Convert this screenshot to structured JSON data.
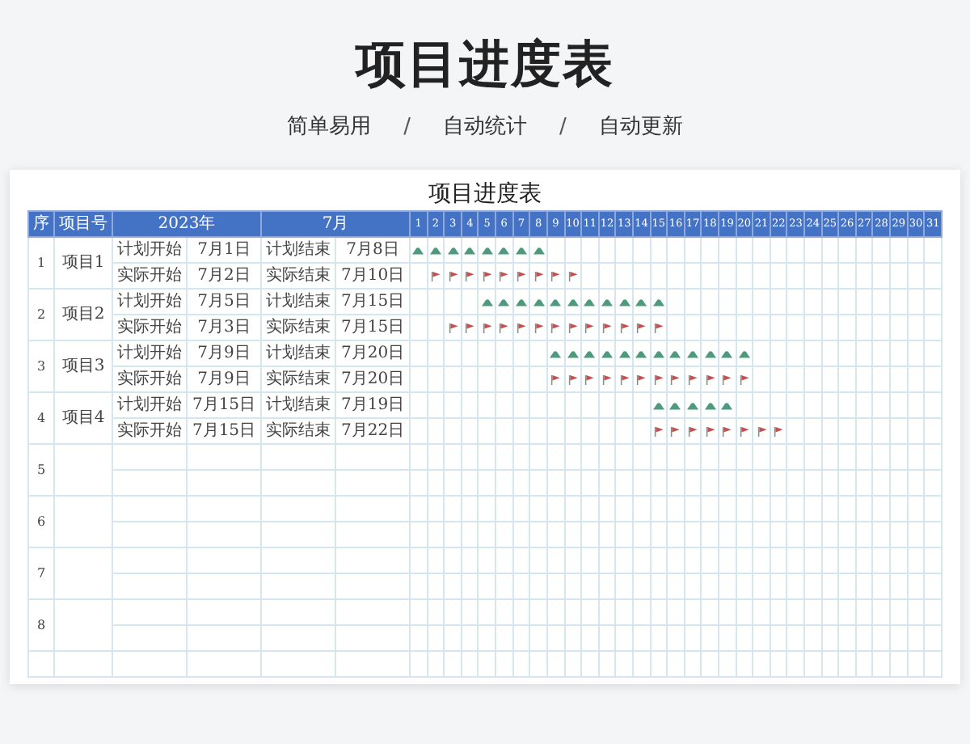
{
  "page_title": "项目进度表",
  "subtitle": [
    {
      "kind": "feature",
      "text": "简单易用"
    },
    {
      "kind": "separator",
      "text": "/"
    },
    {
      "kind": "feature",
      "text": "自动统计"
    },
    {
      "kind": "separator",
      "text": "/"
    },
    {
      "kind": "feature",
      "text": "自动更新"
    }
  ],
  "sheet": {
    "title": "项目进度表",
    "header": {
      "seq": "序",
      "project": "项目号",
      "year": "2023年",
      "month": "7月",
      "days": [
        "1",
        "2",
        "3",
        "4",
        "5",
        "6",
        "7",
        "8",
        "9",
        "10",
        "11",
        "12",
        "13",
        "14",
        "15",
        "16",
        "17",
        "18",
        "19",
        "20",
        "21",
        "22",
        "23",
        "24",
        "25",
        "26",
        "27",
        "28",
        "29",
        "30",
        "31"
      ]
    },
    "projects": [
      {
        "seq": "1",
        "name": "项目1",
        "rows": [
          {
            "kind": "plan",
            "start_label": "计划开始",
            "start": "7月1日",
            "end_label": "计划结束",
            "end": "7月8日",
            "marked": [
              true,
              true,
              true,
              true,
              true,
              true,
              true,
              true,
              false,
              false,
              false,
              false,
              false,
              false,
              false,
              false,
              false,
              false,
              false,
              false,
              false,
              false,
              false,
              false,
              false,
              false,
              false,
              false,
              false,
              false,
              false
            ]
          },
          {
            "kind": "actual",
            "start_label": "实际开始",
            "start": "7月2日",
            "end_label": "实际结束",
            "end": "7月10日",
            "marked": [
              false,
              true,
              true,
              true,
              true,
              true,
              true,
              true,
              true,
              true,
              false,
              false,
              false,
              false,
              false,
              false,
              false,
              false,
              false,
              false,
              false,
              false,
              false,
              false,
              false,
              false,
              false,
              false,
              false,
              false,
              false
            ]
          }
        ]
      },
      {
        "seq": "2",
        "name": "项目2",
        "rows": [
          {
            "kind": "plan",
            "start_label": "计划开始",
            "start": "7月5日",
            "end_label": "计划结束",
            "end": "7月15日",
            "marked": [
              false,
              false,
              false,
              false,
              true,
              true,
              true,
              true,
              true,
              true,
              true,
              true,
              true,
              true,
              true,
              false,
              false,
              false,
              false,
              false,
              false,
              false,
              false,
              false,
              false,
              false,
              false,
              false,
              false,
              false,
              false
            ]
          },
          {
            "kind": "actual",
            "start_label": "实际开始",
            "start": "7月3日",
            "end_label": "实际结束",
            "end": "7月15日",
            "marked": [
              false,
              false,
              true,
              true,
              true,
              true,
              true,
              true,
              true,
              true,
              true,
              true,
              true,
              true,
              true,
              false,
              false,
              false,
              false,
              false,
              false,
              false,
              false,
              false,
              false,
              false,
              false,
              false,
              false,
              false,
              false
            ]
          }
        ]
      },
      {
        "seq": "3",
        "name": "项目3",
        "rows": [
          {
            "kind": "plan",
            "start_label": "计划开始",
            "start": "7月9日",
            "end_label": "计划结束",
            "end": "7月20日",
            "marked": [
              false,
              false,
              false,
              false,
              false,
              false,
              false,
              false,
              true,
              true,
              true,
              true,
              true,
              true,
              true,
              true,
              true,
              true,
              true,
              true,
              false,
              false,
              false,
              false,
              false,
              false,
              false,
              false,
              false,
              false,
              false
            ]
          },
          {
            "kind": "actual",
            "start_label": "实际开始",
            "start": "7月9日",
            "end_label": "实际结束",
            "end": "7月20日",
            "marked": [
              false,
              false,
              false,
              false,
              false,
              false,
              false,
              false,
              true,
              true,
              true,
              true,
              true,
              true,
              true,
              true,
              true,
              true,
              true,
              true,
              false,
              false,
              false,
              false,
              false,
              false,
              false,
              false,
              false,
              false,
              false
            ]
          }
        ]
      },
      {
        "seq": "4",
        "name": "项目4",
        "rows": [
          {
            "kind": "plan",
            "start_label": "计划开始",
            "start": "7月15日",
            "end_label": "计划结束",
            "end": "7月19日",
            "marked": [
              false,
              false,
              false,
              false,
              false,
              false,
              false,
              false,
              false,
              false,
              false,
              false,
              false,
              false,
              true,
              true,
              true,
              true,
              true,
              false,
              false,
              false,
              false,
              false,
              false,
              false,
              false,
              false,
              false,
              false,
              false
            ]
          },
          {
            "kind": "actual",
            "start_label": "实际开始",
            "start": "7月15日",
            "end_label": "实际结束",
            "end": "7月22日",
            "marked": [
              false,
              false,
              false,
              false,
              false,
              false,
              false,
              false,
              false,
              false,
              false,
              false,
              false,
              false,
              true,
              true,
              true,
              true,
              true,
              true,
              true,
              true,
              false,
              false,
              false,
              false,
              false,
              false,
              false,
              false,
              false
            ]
          }
        ]
      },
      {
        "seq": "5"
      },
      {
        "seq": "6"
      },
      {
        "seq": "7"
      },
      {
        "seq": "8"
      }
    ]
  }
}
